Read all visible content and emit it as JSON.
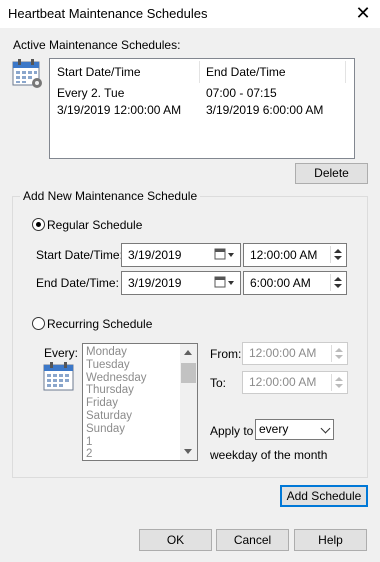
{
  "window": {
    "title": "Heartbeat Maintenance Schedules",
    "close_glyph": "✕"
  },
  "active": {
    "label": "Active Maintenance Schedules:",
    "columns": [
      "Start Date/Time",
      "End Date/Time"
    ],
    "rows": [
      [
        "Every 2. Tue",
        "07:00 - 07:15"
      ],
      [
        "3/19/2019 12:00:00 AM",
        "3/19/2019 6:00:00 AM"
      ]
    ],
    "delete_label": "Delete",
    "icon": "calendar-gear-icon"
  },
  "add": {
    "group_title": "Add New Maintenance Schedule",
    "regular": {
      "label": "Regular Schedule",
      "selected": true,
      "start_label": "Start Date/Time:",
      "start_date": "3/19/2019",
      "start_time": "12:00:00 AM",
      "end_label": "End Date/Time:",
      "end_date": "3/19/2019",
      "end_time": "6:00:00 AM"
    },
    "recurring": {
      "label": "Recurring Schedule",
      "selected": false,
      "every_label": "Every:",
      "options": [
        "Monday",
        "Tuesday",
        "Wednesday",
        "Thursday",
        "Friday",
        "Saturday",
        "Sunday",
        "1",
        "2"
      ],
      "from_label": "From:",
      "from_time": "12:00:00 AM",
      "to_label": "To:",
      "to_time": "12:00:00 AM",
      "apply_label": "Apply to",
      "apply_value": "every",
      "suffix": "weekday of the month"
    },
    "add_label": "Add Schedule"
  },
  "footer": {
    "ok": "OK",
    "cancel": "Cancel",
    "help": "Help"
  },
  "colors": {
    "accent": "#0078d7",
    "button_bg": "#e1e1e1",
    "window_bg": "#f0f0f0"
  }
}
